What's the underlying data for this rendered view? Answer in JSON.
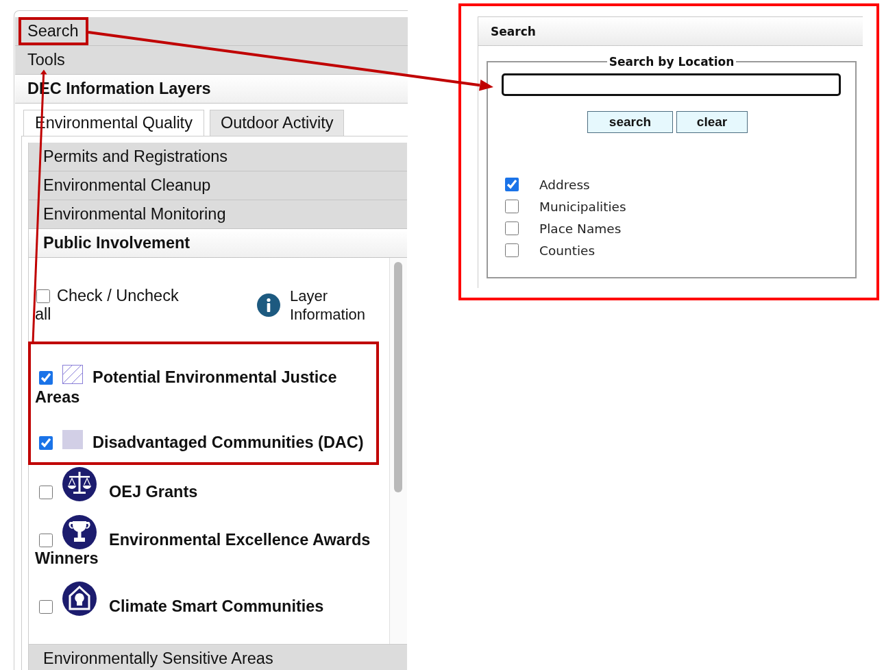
{
  "left_panel": {
    "accordion": [
      {
        "label": "Search",
        "expanded": false
      },
      {
        "label": "Tools",
        "expanded": false
      },
      {
        "label": "DEC Information Layers",
        "expanded": true
      }
    ],
    "tabs": [
      {
        "label": "Environmental Quality",
        "selected": true
      },
      {
        "label": "Outdoor Activity",
        "selected": false
      }
    ],
    "categories": [
      {
        "label": "Permits and Registrations",
        "expanded": false
      },
      {
        "label": "Environmental Cleanup",
        "expanded": false
      },
      {
        "label": "Environmental Monitoring",
        "expanded": false
      },
      {
        "label": "Public Involvement",
        "expanded": true
      },
      {
        "label": "Environmentally Sensitive Areas",
        "expanded": false
      }
    ],
    "check_all": {
      "label": "Check / Uncheck all",
      "checked": false
    },
    "layer_info": {
      "label": "Layer Information"
    },
    "layers": [
      {
        "label": "Potential Environmental Justice Areas",
        "checked": true,
        "kind": "hatched"
      },
      {
        "label": "Disadvantaged Communities (DAC)",
        "checked": true,
        "kind": "solid"
      },
      {
        "label": "OEJ Grants",
        "checked": false,
        "kind": "scales"
      },
      {
        "label": "Environmental Excellence Awards Winners",
        "checked": false,
        "kind": "trophy"
      },
      {
        "label": "Climate Smart Communities",
        "checked": false,
        "kind": "house"
      }
    ]
  },
  "search_panel": {
    "title": "Search",
    "legend": "Search by Location",
    "buttons": [
      "search",
      "clear"
    ],
    "options": [
      {
        "label": "Address",
        "checked": true
      },
      {
        "label": "Municipalities",
        "checked": false
      },
      {
        "label": "Place Names",
        "checked": false
      },
      {
        "label": "Counties",
        "checked": false
      }
    ]
  }
}
